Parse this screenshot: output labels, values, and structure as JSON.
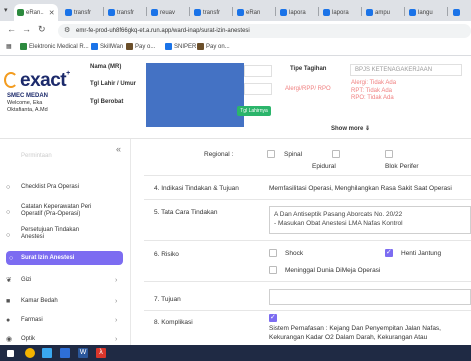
{
  "browser": {
    "tabs": [
      {
        "label": "eRan..",
        "active": true
      },
      {
        "label": "transfr"
      },
      {
        "label": "transfr"
      },
      {
        "label": "reuav"
      },
      {
        "label": "transfr"
      },
      {
        "label": "eRan"
      },
      {
        "label": "lapora"
      },
      {
        "label": "lapora"
      },
      {
        "label": "ampu"
      },
      {
        "label": "langu"
      }
    ],
    "url": "emr-fe-prod-uh8f66gkq-et.a.run.app/ward-inap/surat-izin-anestesi",
    "bookmarks": [
      {
        "label": "Elektronic Medical R...",
        "color": "#2c8a3e"
      },
      {
        "label": "SkillWan",
        "color": "#1a73e8"
      },
      {
        "label": "Pay o...",
        "color": "#6b4f2a"
      },
      {
        "label": "SNIPER",
        "color": "#1a73e8"
      },
      {
        "label": "Pay on...",
        "color": "#6b4f2a"
      }
    ]
  },
  "header": {
    "logo": "exact",
    "hospital": "SMEC MEDAN",
    "welcome": "Welcome, Eka",
    "welcome_role": "Oktafianta, A.Md",
    "labels": {
      "name": "Nama (MR)",
      "dob": "Tgl Lahir / Umur",
      "visit": "Tgl Berobat",
      "payment": "Tipe Tagihan",
      "allergy": "Alergi/RPP/ RPO"
    },
    "payment_value": "BPJS KETENAGAKERJAAN",
    "green_button": "Tgl Lahirnya",
    "allergy_values": [
      "Alergi: Tidak Ada",
      "RPT: Tidak Ada",
      "RPO: Tidak Ada"
    ],
    "show_more": "Show more ⇓"
  },
  "sidebar": {
    "items": [
      {
        "label": "Permintaan",
        "icon": "doc-icon",
        "faded": true
      },
      {
        "label": "Checklist Pra Operasi",
        "icon": "circle-icon"
      },
      {
        "label": "Catatan Keperawatan Peri Operatif (Pra-Operasi)",
        "icon": "circle-icon"
      },
      {
        "label": "Persetujuan Tindakan Anestesi",
        "icon": "circle-icon"
      },
      {
        "label": "Surat Izin Anestesi",
        "icon": "circle-icon",
        "active": true
      },
      {
        "label": "Gizi",
        "icon": "spoon-icon"
      },
      {
        "label": "Kamar Bedah",
        "icon": "bed-icon"
      },
      {
        "label": "Farmasi",
        "icon": "pill-icon"
      },
      {
        "label": "Optik",
        "icon": "eye-icon"
      }
    ]
  },
  "form": {
    "regional_label": "Regional :",
    "regional_options": [
      "Spinal",
      "Epidural",
      "Blok Perifer"
    ],
    "q4_label": "4. Indikasi Tindakan & Tujuan",
    "q4_value": "Memfasilitasi Operasi, Menghilangkan Rasa Sakit Saat Operasi",
    "q5_label": "5. Tata Cara Tindakan",
    "q5_value_1": "A Dan Antiseptik Pasang Aborcats No. 20/22",
    "q5_value_2": "- Masukan Obat Anestesi LMA Nafas Kontrol",
    "q6_label": "6. Risiko",
    "q6_options": [
      "Shock",
      "Henti Jantung",
      "Meninggal Dunia DiMeja Operasi"
    ],
    "q7_label": "7. Tujuan",
    "q8_label": "8. Komplikasi",
    "q8_value_1": "Sistem Pernafasan : Kejang Dan Penyempitan Jalan Nafas,",
    "q8_value_2": "Kekurangan Kadar O2 Dalam Darah, Kekurangan Atau"
  }
}
